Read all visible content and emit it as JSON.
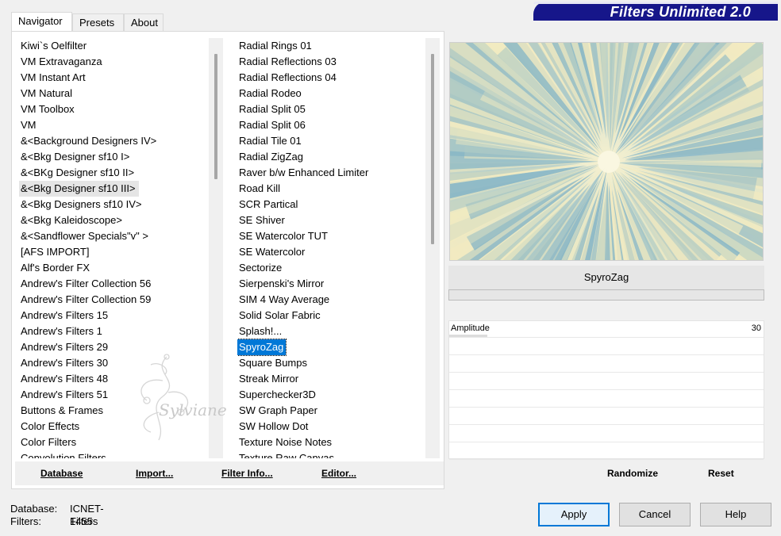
{
  "app": {
    "title": "Filters Unlimited 2.0"
  },
  "tabs": [
    {
      "label": "Navigator",
      "active": true
    },
    {
      "label": "Presets",
      "active": false
    },
    {
      "label": "About",
      "active": false
    }
  ],
  "categories": {
    "items": [
      "Kiwi`s Oelfilter",
      "VM Extravaganza",
      "VM Instant Art",
      "VM Natural",
      "VM Toolbox",
      "VM",
      "&<Background Designers IV>",
      "&<Bkg Designer sf10 I>",
      "&<BKg Designer sf10 II>",
      "&<Bkg Designer sf10 III>",
      "&<Bkg Designers sf10 IV>",
      "&<Bkg Kaleidoscope>",
      "&<Sandflower Specials\"v\" >",
      "[AFS IMPORT]",
      "Alf's Border FX",
      "Andrew's Filter Collection 56",
      "Andrew's Filter Collection 59",
      "Andrew's Filters 15",
      "Andrew's Filters 1",
      "Andrew's Filters 29",
      "Andrew's Filters 30",
      "Andrew's Filters 48",
      "Andrew's Filters 51",
      "Buttons & Frames",
      "Color Effects",
      "Color Filters",
      "Convolution Filters"
    ],
    "selected_index": 9
  },
  "filters": {
    "items": [
      "Radial  Rings 01",
      "Radial Reflections 03",
      "Radial Reflections 04",
      "Radial Rodeo",
      "Radial Split 05",
      "Radial Split 06",
      "Radial Tile 01",
      "Radial ZigZag",
      "Raver b/w Enhanced Limiter",
      "Road Kill",
      "SCR  Partical",
      "SE Shiver",
      "SE Watercolor TUT",
      "SE Watercolor",
      "Sectorize",
      "Sierpenski's Mirror",
      "SIM 4 Way Average",
      "Solid Solar Fabric",
      "Splash!...",
      "SpyroZag",
      "Square Bumps",
      "Streak Mirror",
      "Superchecker3D",
      "SW Graph Paper",
      "SW Hollow Dot",
      "Texture Noise Notes",
      "Texture Raw Canvas"
    ],
    "selected_index": 19
  },
  "left_buttons": {
    "database": "Database",
    "import": "Import...",
    "filter_info": "Filter Info...",
    "editor": "Editor..."
  },
  "current_filter": {
    "name": "SpyroZag",
    "progress": 0
  },
  "params": [
    {
      "label": "Amplitude",
      "value": "30",
      "fraction": 0.12
    }
  ],
  "right_buttons": {
    "randomize": "Randomize",
    "reset": "Reset"
  },
  "footer": {
    "database_label": "Database:",
    "database_value": "ICNET-Filters",
    "filters_label": "Filters:",
    "filters_value": "1455"
  },
  "dialog_buttons": {
    "apply": "Apply",
    "cancel": "Cancel",
    "help": "Help"
  },
  "watermark": {
    "text": "Sylviane"
  },
  "colors": {
    "title_banner": "#16168a",
    "selection": "#0078d7",
    "preview_light": "#f3ebc0",
    "preview_blue": "#7fb2c6"
  }
}
